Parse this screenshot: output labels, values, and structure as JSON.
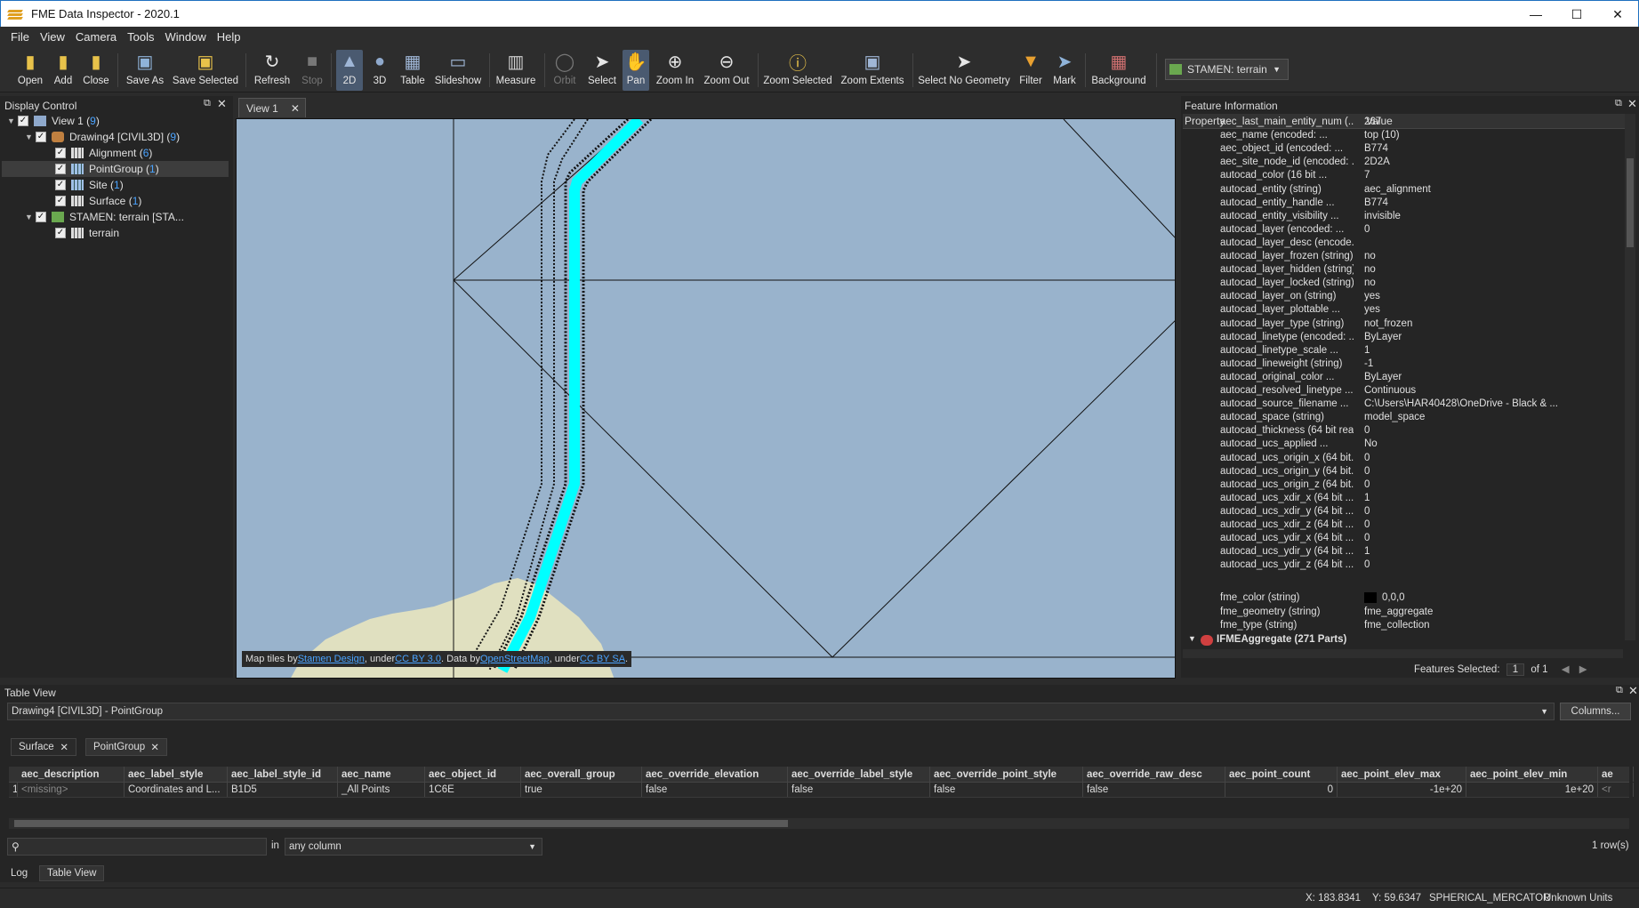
{
  "app": {
    "title": "FME Data Inspector - 2020.1",
    "window_controls": [
      "minimize-icon",
      "maximize-icon",
      "close-icon"
    ]
  },
  "menu": [
    "File",
    "View",
    "Camera",
    "Tools",
    "Window",
    "Help"
  ],
  "toolbar": {
    "open": "Open",
    "add": "Add",
    "close": "Close",
    "save_as": "Save As",
    "save_selected": "Save Selected",
    "refresh": "Refresh",
    "stop": "Stop",
    "view_2d": "2D",
    "view_3d": "3D",
    "table": "Table",
    "slideshow": "Slideshow",
    "measure": "Measure",
    "orbit": "Orbit",
    "select": "Select",
    "pan": "Pan",
    "zoom_in": "Zoom In",
    "zoom_out": "Zoom Out",
    "zoom_selected": "Zoom Selected",
    "zoom_extents": "Zoom Extents",
    "select_no_geometry": "Select No Geometry",
    "filter": "Filter",
    "mark": "Mark",
    "background": "Background",
    "background_value": "STAMEN: terrain"
  },
  "display_control": {
    "title": "Display Control",
    "tree": [
      {
        "label": "View 1 (",
        "count": "9",
        "suffix": ")"
      },
      {
        "label": "Drawing4 [CIVIL3D] (",
        "count": "9",
        "suffix": ")"
      },
      {
        "label": "Alignment (",
        "count": "6",
        "suffix": ")"
      },
      {
        "label": "PointGroup (",
        "count": "1",
        "suffix": ")"
      },
      {
        "label": "Site (",
        "count": "1",
        "suffix": ")"
      },
      {
        "label": "Surface (",
        "count": "1",
        "suffix": ")"
      },
      {
        "label": "STAMEN: terrain [STA...",
        "count": "",
        "suffix": ""
      },
      {
        "label": "terrain",
        "count": "",
        "suffix": ""
      }
    ]
  },
  "view": {
    "tab": "View 1",
    "attribution": {
      "prefix": "Map tiles by ",
      "l1": "Stamen Design",
      "t1": ", under ",
      "l2": "CC BY 3.0",
      "t2": ". Data by ",
      "l3": "OpenStreetMap",
      "t3": ", under ",
      "l4": "CC BY SA",
      "t4": "."
    }
  },
  "feature_info": {
    "title": "Feature Information",
    "col_property": "Property",
    "col_value": "Value",
    "rows": [
      [
        "aec_last_main_entity_num (...",
        "267"
      ],
      [
        "aec_name (encoded: ...",
        "top (10)"
      ],
      [
        "aec_object_id (encoded: ...",
        "B774"
      ],
      [
        "aec_site_node_id (encoded: ...",
        "2D2A"
      ],
      [
        "autocad_color (16 bit ...",
        "7"
      ],
      [
        "autocad_entity (string)",
        "aec_alignment"
      ],
      [
        "autocad_entity_handle ...",
        "B774"
      ],
      [
        "autocad_entity_visibility ...",
        "invisible"
      ],
      [
        "autocad_layer (encoded: ...",
        "0"
      ],
      [
        "autocad_layer_desc (encode...",
        ""
      ],
      [
        "autocad_layer_frozen (string)",
        "no"
      ],
      [
        "autocad_layer_hidden (string)",
        "no"
      ],
      [
        "autocad_layer_locked (string)",
        "no"
      ],
      [
        "autocad_layer_on (string)",
        "yes"
      ],
      [
        "autocad_layer_plottable ...",
        "yes"
      ],
      [
        "autocad_layer_type (string)",
        "not_frozen"
      ],
      [
        "autocad_linetype (encoded: ...",
        "ByLayer"
      ],
      [
        "autocad_linetype_scale ...",
        "1"
      ],
      [
        "autocad_lineweight (string)",
        "-1"
      ],
      [
        "autocad_original_color ...",
        "ByLayer"
      ],
      [
        "autocad_resolved_linetype ...",
        "Continuous"
      ],
      [
        "autocad_source_filename ...",
        "C:\\Users\\HAR40428\\OneDrive - Black & ..."
      ],
      [
        "autocad_space (string)",
        "model_space"
      ],
      [
        "autocad_thickness (64 bit real)",
        "0"
      ],
      [
        "autocad_ucs_applied ...",
        "No"
      ],
      [
        "autocad_ucs_origin_x (64 bit...",
        "0"
      ],
      [
        "autocad_ucs_origin_y (64 bit...",
        "0"
      ],
      [
        "autocad_ucs_origin_z (64 bit...",
        "0"
      ],
      [
        "autocad_ucs_xdir_x (64 bit ...",
        "1"
      ],
      [
        "autocad_ucs_xdir_y (64 bit ...",
        "0"
      ],
      [
        "autocad_ucs_xdir_z (64 bit ...",
        "0"
      ],
      [
        "autocad_ucs_ydir_x (64 bit ...",
        "0"
      ],
      [
        "autocad_ucs_ydir_y (64 bit ...",
        "1"
      ],
      [
        "autocad_ucs_ydir_z (64 bit ...",
        "0"
      ]
    ],
    "fme_rows": [
      [
        "fme_color (string)",
        "0,0,0"
      ],
      [
        "fme_geometry (string)",
        "fme_aggregate"
      ],
      [
        "fme_type (string)",
        "fme_collection"
      ]
    ],
    "aggregate": "IFMEAggregate (271 Parts)",
    "features_selected_label": "Features Selected:",
    "features_selected_value": "1",
    "features_selected_of": "of 1"
  },
  "table_view": {
    "title": "Table View",
    "source": "Drawing4 [CIVIL3D] - PointGroup",
    "columns_button": "Columns...",
    "tabs": [
      "Surface",
      "PointGroup"
    ],
    "headers": [
      "aec_description",
      "aec_label_style",
      "aec_label_style_id",
      "aec_name",
      "aec_object_id",
      "aec_overall_group",
      "aec_override_elevation",
      "aec_override_label_style",
      "aec_override_point_style",
      "aec_override_raw_desc",
      "aec_point_count",
      "aec_point_elev_max",
      "aec_point_elev_min",
      "ae"
    ],
    "row_num": "1",
    "row": [
      "<missing>",
      "Coordinates and L...",
      "B1D5",
      "_All Points",
      "1C6E",
      "true",
      "false",
      "false",
      "false",
      "false",
      "0",
      "-1e+20",
      "1e+20",
      "<r"
    ],
    "search_in": "in",
    "search_scope": "any column",
    "row_count": "1 row(s)"
  },
  "bottom_tabs": [
    "Log",
    "Table View"
  ],
  "status": {
    "x_label": "X:",
    "x": "183.8341",
    "y_label": "Y:",
    "y": "59.6347",
    "crs": "SPHERICAL_MERCATOR",
    "units": "Unknown Units"
  },
  "colors": {
    "map_water": "#99b3cc",
    "land": "#e0e0c0",
    "selection": "#00ffff"
  }
}
